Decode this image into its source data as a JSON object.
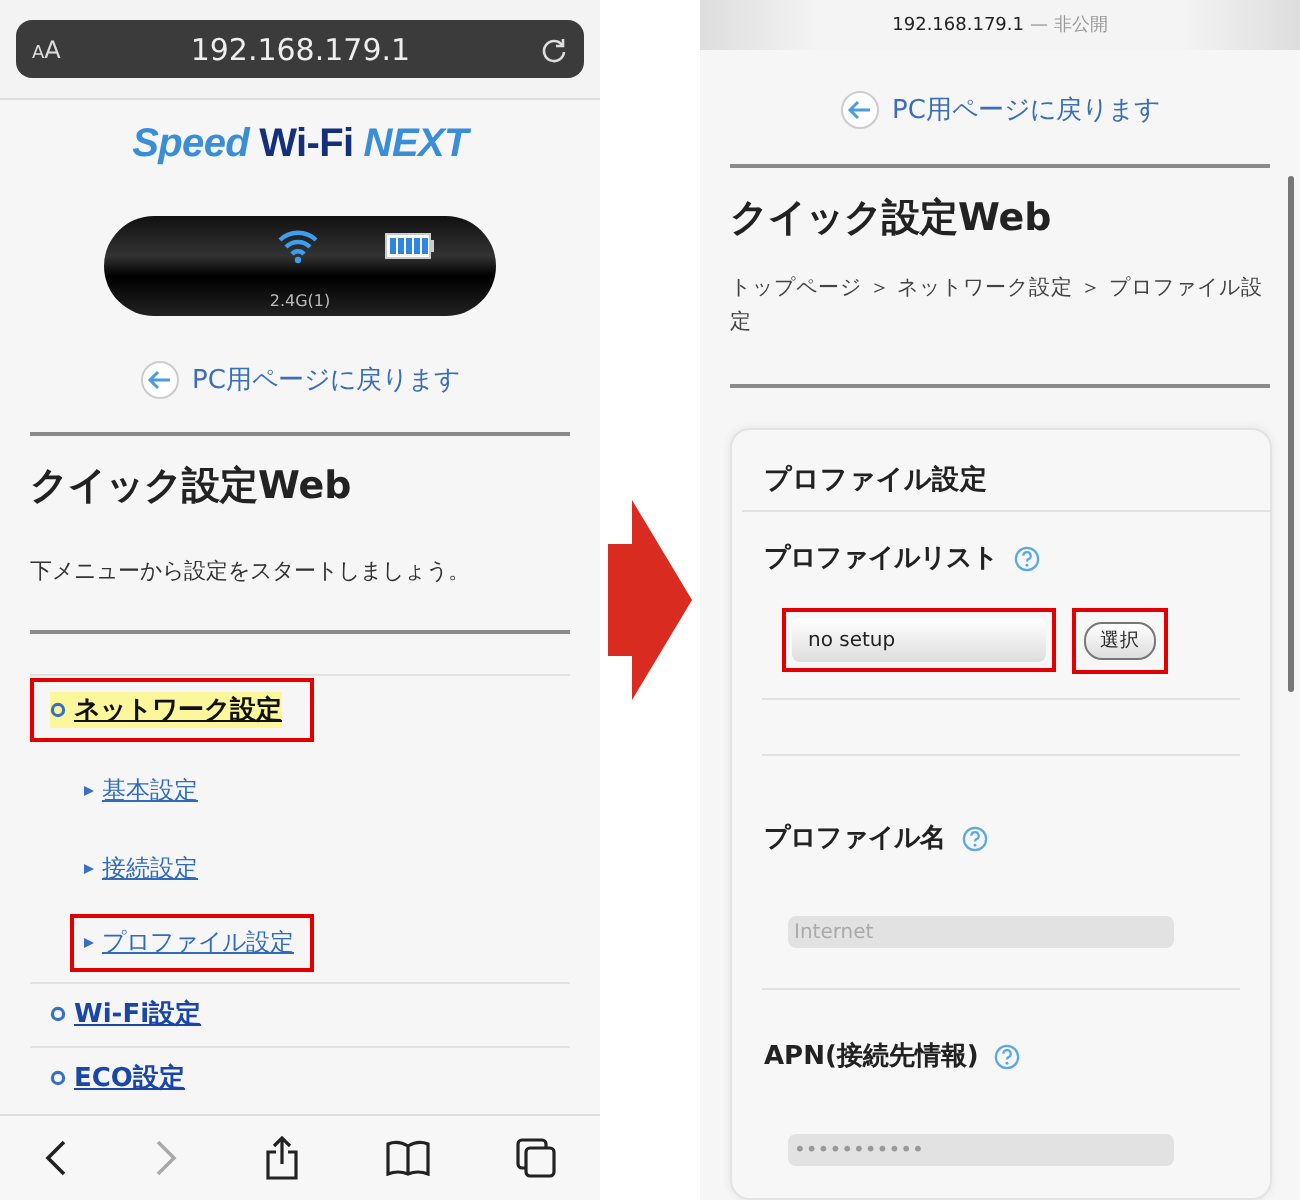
{
  "left_screen": {
    "address_bar": {
      "text_size": "AA",
      "url": "192.168.179.1"
    },
    "logo": {
      "parts": [
        "Speed",
        "Wi-Fi",
        "NEXT"
      ]
    },
    "device": {
      "band": "2.4G(1)"
    },
    "back_link": "PC用ページに戻ります",
    "title": "クイック設定Web",
    "intro": "下メニューから設定をスタートしましょう。",
    "menu": [
      {
        "label": "ネットワーク設定",
        "selected": true,
        "marked": true,
        "children": [
          {
            "label": "基本設定",
            "marked": false
          },
          {
            "label": "接続設定",
            "marked": false
          },
          {
            "label": "プロファイル設定",
            "marked": true
          }
        ]
      },
      {
        "label": "Wi-Fi設定",
        "selected": false,
        "marked": false
      },
      {
        "label": "ECO設定",
        "selected": false,
        "marked": false
      }
    ]
  },
  "right_screen": {
    "address": {
      "url": "192.168.179.1",
      "privacy": "— 非公開"
    },
    "back_link": "PC用ページに戻ります",
    "title": "クイック設定Web",
    "breadcrumb": "トップページ ＞ ネットワーク設定 ＞ プロファイル設定",
    "card": {
      "title": "プロファイル設定",
      "profile_list": {
        "label": "プロファイルリスト",
        "select": {
          "value": "no setup",
          "marked": true
        },
        "button": {
          "label": "選択",
          "marked": true
        }
      },
      "fields": [
        {
          "label": "プロファイル名",
          "placeholder": "Internet",
          "disabled": true
        },
        {
          "label": "APN(接続先情報)",
          "value": "•••••••••••",
          "disabled": true
        }
      ]
    }
  }
}
